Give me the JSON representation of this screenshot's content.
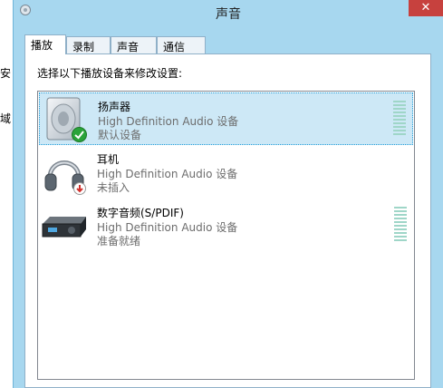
{
  "background": {
    "fragments": [
      "安",
      "域"
    ]
  },
  "window": {
    "title": "声音",
    "close_glyph": "✕"
  },
  "tabs": [
    {
      "label": "播放",
      "active": true
    },
    {
      "label": "录制",
      "active": false
    },
    {
      "label": "声音",
      "active": false
    },
    {
      "label": "通信",
      "active": false
    }
  ],
  "instructions": "选择以下播放设备来修改设置:",
  "devices": [
    {
      "name": "扬声器",
      "description": "High Definition Audio 设备",
      "status": "默认设备",
      "icon": "speaker-icon",
      "badge": "default-check-icon",
      "selected": true
    },
    {
      "name": "耳机",
      "description": "High Definition Audio 设备",
      "status": "未插入",
      "icon": "headphones-icon",
      "badge": "unplugged-icon",
      "selected": false
    },
    {
      "name": "数字音频(S/PDIF)",
      "description": "High Definition Audio 设备",
      "status": "准备就绪",
      "icon": "digital-audio-receiver-icon",
      "badge": null,
      "selected": false
    }
  ],
  "colors": {
    "frame": "#a7d7ef",
    "selection": "#cde8f6",
    "close": "#c7413e",
    "meter_bar": "#9fd6c8",
    "check_badge": "#2aa33a",
    "unplugged_badge": "#d0312d"
  }
}
